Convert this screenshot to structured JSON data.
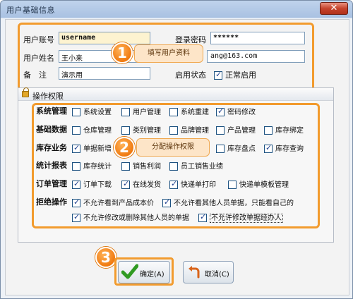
{
  "window": {
    "title": "用户基础信息",
    "close": "✕"
  },
  "form": {
    "account_label": "用户账号",
    "account_value": "username",
    "password_label": "登录密码",
    "password_value": "******",
    "name_label": "用户姓名",
    "name_value": "王小来",
    "email_value": "ang@163.com",
    "note_label": "备　注",
    "note_value": "演示用",
    "status_label": "启用状态",
    "status_option": "正常启用",
    "status_checked": true
  },
  "callouts": [
    {
      "num": "1",
      "text": "填写用户资料"
    },
    {
      "num": "2",
      "text": "分配操作权限"
    },
    {
      "num": "3"
    }
  ],
  "permissions": {
    "title": "操作权限",
    "rows": [
      {
        "label": "系统管理",
        "options": [
          {
            "text": "系统设置",
            "checked": false
          },
          {
            "text": "用户管理",
            "checked": false
          },
          {
            "text": "系统重建",
            "checked": false
          },
          {
            "text": "密码修改",
            "checked": true
          }
        ]
      },
      {
        "label": "基础数据",
        "options": [
          {
            "text": "仓库管理",
            "checked": false
          },
          {
            "text": "类别管理",
            "checked": false
          },
          {
            "text": "品牌管理",
            "checked": false
          },
          {
            "text": "产品管理",
            "checked": false
          },
          {
            "text": "库存绑定",
            "checked": false
          }
        ]
      },
      {
        "label": "库存业务",
        "options": [
          {
            "text": "单据新增",
            "checked": true
          },
          {
            "text": "库存盘点",
            "checked": false
          },
          {
            "text": "库存查询",
            "checked": true
          }
        ]
      },
      {
        "label": "统计报表",
        "options": [
          {
            "text": "库存统计",
            "checked": false
          },
          {
            "text": "销售利润",
            "checked": false
          },
          {
            "text": "员工销售业绩",
            "checked": false
          }
        ]
      },
      {
        "label": "订单管理",
        "options": [
          {
            "text": "订单下载",
            "checked": true
          },
          {
            "text": "在线发货",
            "checked": true
          },
          {
            "text": "快递单打印",
            "checked": true
          },
          {
            "text": "快递单模板管理",
            "checked": false
          }
        ]
      },
      {
        "label": "拒绝操作",
        "options": [
          {
            "text": "不允许看到产品成本价",
            "checked": true
          },
          {
            "text": "不允许看其他人员单据，只能看自己的",
            "checked": true
          },
          {
            "text": "不允许修改或删除其他人员的单据",
            "checked": true
          },
          {
            "text": "不允许修改单据经办人",
            "checked": true
          }
        ]
      }
    ]
  },
  "buttons": {
    "ok": "确定(A)",
    "cancel": "取消(C)"
  },
  "colors": {
    "accent_orange": "#f29b2e",
    "badge": "#f07a10",
    "titlebar": "#bfd3ec"
  }
}
